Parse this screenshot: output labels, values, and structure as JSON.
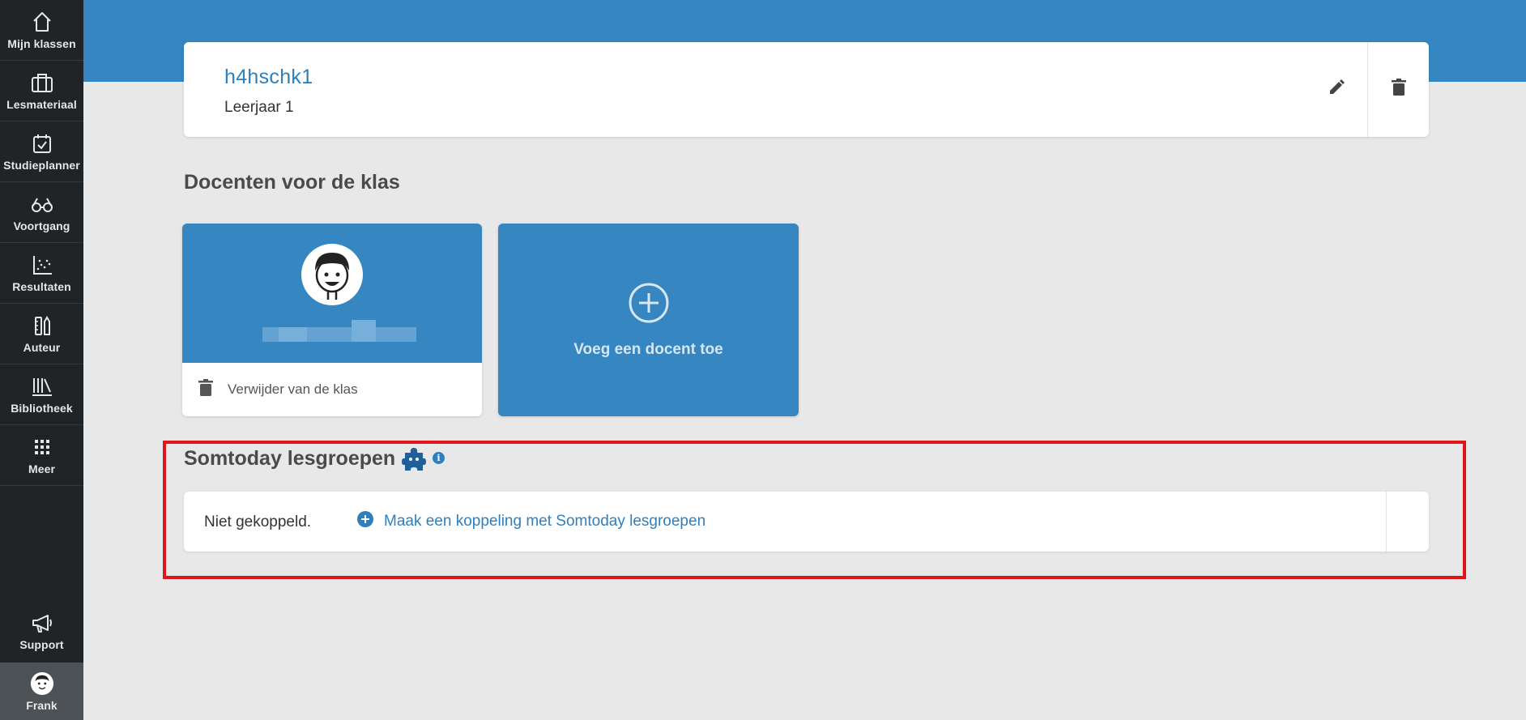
{
  "sidebar": {
    "items": [
      {
        "label": "Mijn klassen",
        "icon": "home-icon"
      },
      {
        "label": "Lesmateriaal",
        "icon": "briefcase-icon"
      },
      {
        "label": "Studieplanner",
        "icon": "calendar-check-icon"
      },
      {
        "label": "Voortgang",
        "icon": "glasses-icon"
      },
      {
        "label": "Resultaten",
        "icon": "scatter-chart-icon"
      },
      {
        "label": "Auteur",
        "icon": "author-tools-icon"
      },
      {
        "label": "Bibliotheek",
        "icon": "library-icon"
      },
      {
        "label": "Meer",
        "icon": "grid-dots-icon"
      }
    ],
    "support": {
      "label": "Support",
      "icon": "megaphone-icon"
    },
    "user": {
      "label": "Frank",
      "icon": "user-avatar-icon"
    }
  },
  "class_card": {
    "name": "h4hschk1",
    "year": "Leerjaar 1"
  },
  "teachers_section": {
    "title": "Docenten voor de klas",
    "remove_label": "Verwijder van de klas",
    "add_label": "Voeg een docent toe"
  },
  "somtoday": {
    "title": "Somtoday lesgroepen",
    "info": "i",
    "status": "Niet gekoppeld.",
    "link_label": "Maak een koppeling met Somtoday lesgroepen"
  },
  "colors": {
    "brand_blue": "#3586c1",
    "link_blue": "#2f7fbd",
    "sidebar_bg": "#202427",
    "highlight_red": "#e0151b"
  }
}
